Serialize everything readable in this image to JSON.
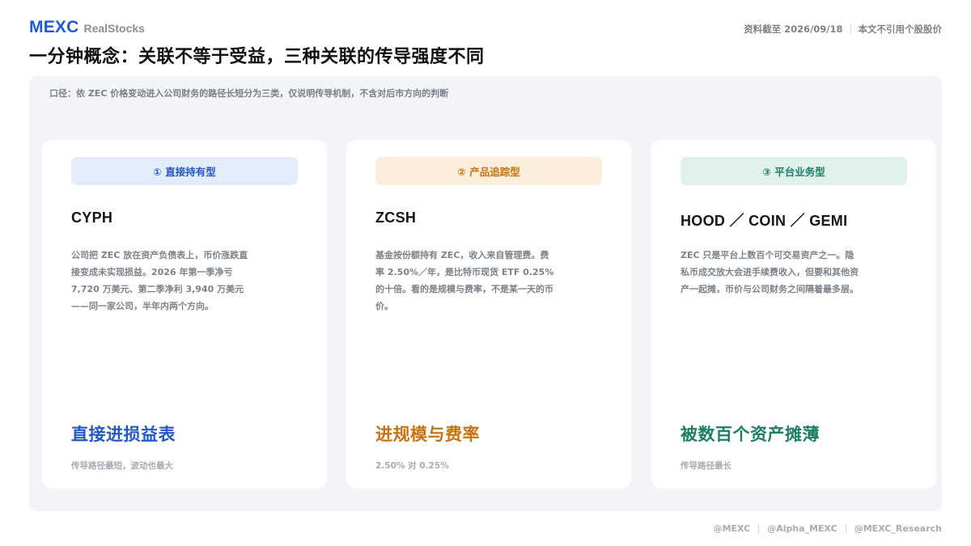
{
  "brand": {
    "name": "MEXC",
    "sub": "RealStocks"
  },
  "meta": {
    "date": "资料截至 2026/09/18",
    "disclaimer": "本文不引用个股股价"
  },
  "title": "一分钟概念：关联不等于受益，三种关联的传导强度不同",
  "note": "口径：依 ZEC 价格变动进入公司财务的路径长短分为三类，仅说明传导机制，不含对后市方向的判断",
  "cards": [
    {
      "tag": "① 直接持有型",
      "ticker": "CYPH",
      "desc": "公司把 ZEC 放在资产负债表上，币价涨跌直接变成未实现损益。2026 年第一季净亏 7,720 万美元、第二季净利 3,940 万美元——同一家公司，半年内两个方向。",
      "verdict": "直接进损益表",
      "foot": "传导路径最短，波动也最大",
      "accent": "#2458c7"
    },
    {
      "tag": "② 产品追踪型",
      "ticker": "ZCSH",
      "desc": "基金按份额持有 ZEC，收入来自管理费。费率 2.50%／年，是比特币现货 ETF 0.25% 的十倍。看的是规模与费率，不是某一天的币价。",
      "verdict": "进规模与费率",
      "foot": "2.50% 对 0.25%",
      "accent": "#c8720d"
    },
    {
      "tag": "③ 平台业务型",
      "ticker": "HOOD ／ COIN ／ GEMI",
      "desc": "ZEC 只是平台上数百个可交易资产之一。隐私币成交放大会进手续费收入，但要和其他资产一起摊，币价与公司财务之间隔着最多层。",
      "verdict": "被数百个资产摊薄",
      "foot": "传导路径最长",
      "accent": "#1d7f63"
    }
  ],
  "social": [
    "@MEXC",
    "@Alpha_MEXC",
    "@MEXC_Research"
  ]
}
